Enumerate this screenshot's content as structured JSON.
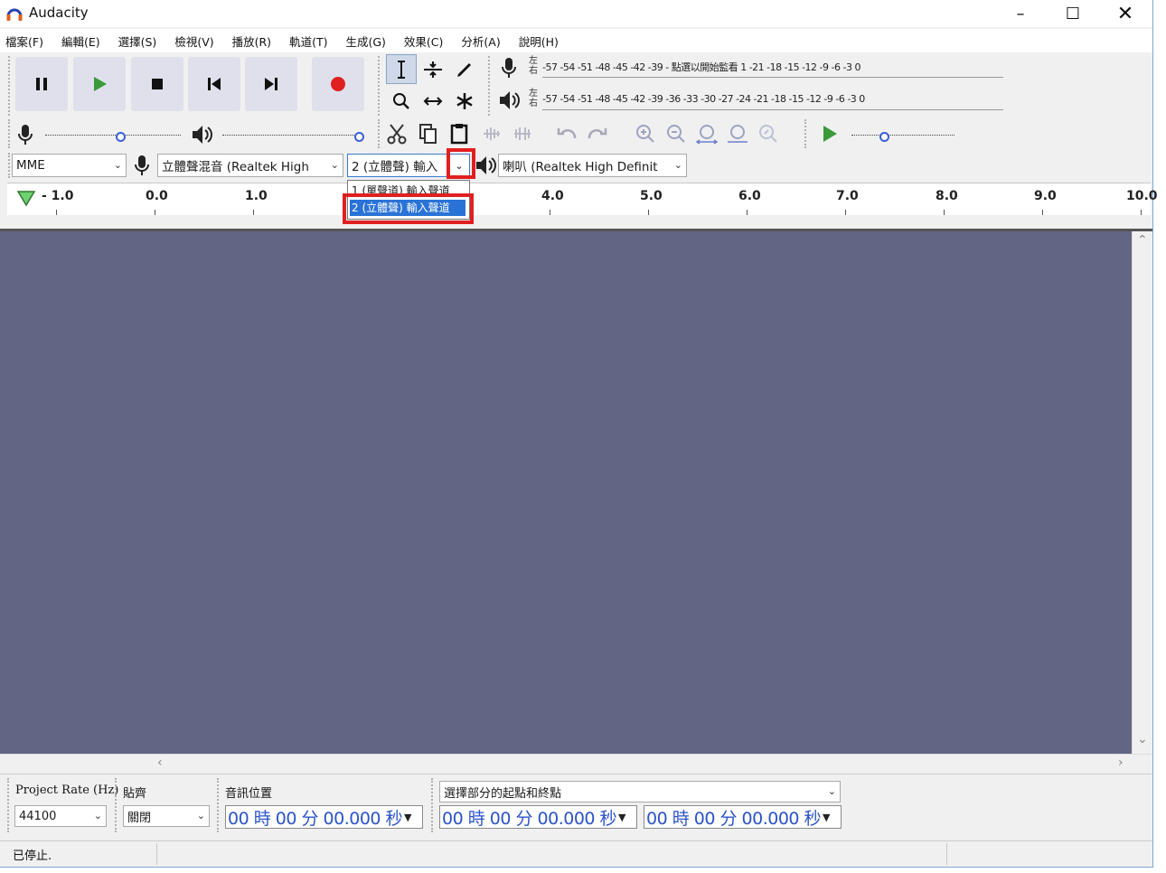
{
  "window": {
    "title": "Audacity"
  },
  "menu": [
    "檔案(F)",
    "編輯(E)",
    "選擇(S)",
    "檢視(V)",
    "播放(R)",
    "軌道(T)",
    "生成(G)",
    "效果(C)",
    "分析(A)",
    "說明(H)"
  ],
  "meters": {
    "record_lr": "左\n右",
    "play_lr": "左\n右",
    "record_scale": "-57 -54 -51 -48 -45 -42 -39 - 點選以開始監看 1 -21 -18 -15 -12 -9 -6 -3 0",
    "play_scale": "-57 -54 -51 -48 -45 -42 -39 -36 -33 -30 -27 -24 -21 -18 -15 -12 -9 -6 -3 0"
  },
  "device": {
    "host": "MME",
    "record_device": "立體聲混音 (Realtek High",
    "channels": "2 (立體聲) 輸入",
    "playback_device": "喇叭 (Realtek High Definit"
  },
  "channel_options": [
    "1 (單聲道) 輸入聲道",
    "2 (立體聲) 輸入聲道"
  ],
  "ruler": {
    "labels": [
      "- 1.0",
      "0.0",
      "1.0",
      "4.0",
      "5.0",
      "6.0",
      "7.0",
      "8.0",
      "9.0",
      "10.0"
    ]
  },
  "selection": {
    "rate_label": "Project Rate (Hz)",
    "rate_value": "44100",
    "snap_label": "貼齊",
    "snap_value": "關閉",
    "position_label": "音訊位置",
    "position_value": "00 時 00 分 00.000 秒",
    "range_label": "選擇部分的起點和終點",
    "start_value": "00 時 00 分 00.000 秒",
    "end_value": "00 時 00 分 00.000 秒"
  },
  "status": {
    "text": "已停止."
  },
  "colors": {
    "track_bg": "#636585",
    "accent_blue": "#2b53c8",
    "highlight_red": "#e02020",
    "play_green": "#3a9a3a",
    "record_red": "#e02020"
  }
}
